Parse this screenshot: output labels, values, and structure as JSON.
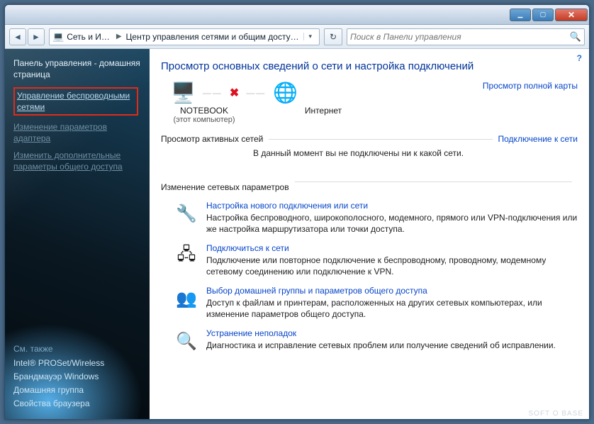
{
  "breadcrumb": {
    "root": "Сеть и Ин...",
    "current": "Центр управления сетями и общим доступом"
  },
  "search": {
    "placeholder": "Поиск в Панели управления"
  },
  "sidebar": {
    "home": "Панель управления - домашняя страница",
    "links": [
      "Управление беспроводными сетями",
      "Изменение параметров адаптера",
      "Изменить дополнительные параметры общего доступа"
    ],
    "see_also_header": "См. также",
    "see_also": [
      "Intel® PROSet/Wireless",
      "Брандмауэр Windows",
      "Домашняя группа",
      "Свойства браузера"
    ]
  },
  "main": {
    "title": "Просмотр основных сведений о сети и настройка подключений",
    "map_full": "Просмотр полной карты",
    "computer": "NOTEBOOK",
    "computer_sub": "(этот компьютер)",
    "internet": "Интернет",
    "active_header": "Просмотр активных сетей",
    "connect_link": "Подключение к сети",
    "no_network": "В данный момент вы не подключены ни к какой сети.",
    "settings_header": "Изменение сетевых параметров",
    "settings": [
      {
        "title": "Настройка нового подключения или сети",
        "desc": "Настройка беспроводного, широкополосного, модемного, прямого или VPN-подключения или же настройка маршрутизатора или точки доступа."
      },
      {
        "title": "Подключиться к сети",
        "desc": "Подключение или повторное подключение к беспроводному, проводному, модемному сетевому соединению или подключение к VPN."
      },
      {
        "title": "Выбор домашней группы и параметров общего доступа",
        "desc": "Доступ к файлам и принтерам, расположенных на других сетевых компьютерах, или изменение параметров общего доступа."
      },
      {
        "title": "Устранение неполадок",
        "desc": "Диагностика и исправление сетевых проблем или получение сведений об исправлении."
      }
    ]
  },
  "watermark": "SOFT O BASE"
}
